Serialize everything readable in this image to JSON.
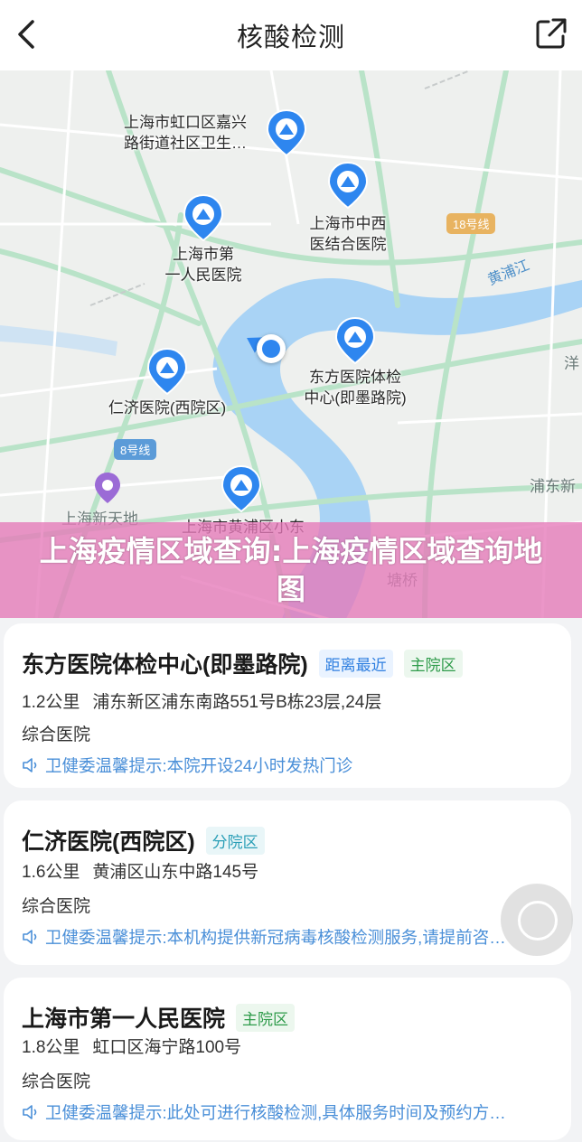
{
  "header": {
    "title": "核酸检测"
  },
  "map": {
    "pins": [
      {
        "label": "上海市虹口区嘉兴\n路街道社区卫生…"
      },
      {
        "label": "上海市中西\n医结合医院"
      },
      {
        "label": "上海市第\n一人民医院"
      },
      {
        "label": "东方医院体检\n中心(即墨路院)"
      },
      {
        "label": "仁济医院(西院区)"
      },
      {
        "label": "上海市黄浦区小东"
      }
    ],
    "metro_badges": [
      "18号线",
      "8号线"
    ],
    "place_labels": {
      "xintiandi": "上海新天地",
      "pudong": "浦东新",
      "tangqiao": "塘桥",
      "yang": "洋",
      "river": "黄浦江"
    }
  },
  "banner": {
    "text": "上海疫情区域查询:上海疫情区域查询地图"
  },
  "hospitals": [
    {
      "name": "东方医院体检中心(即墨路院)",
      "tags": [
        {
          "text": "距离最近",
          "color": "blue"
        },
        {
          "text": "主院区",
          "color": "green"
        }
      ],
      "distance": "1.2公里",
      "address": "浦东新区浦东南路551号B栋23层,24层",
      "type": "综合医院",
      "tip": "卫健委温馨提示:本院开设24小时发热门诊"
    },
    {
      "name": "仁济医院(西院区)",
      "tags": [
        {
          "text": "分院区",
          "color": "cyan"
        }
      ],
      "distance": "1.6公里",
      "address": "黄浦区山东中路145号",
      "type": "综合医院",
      "tip": "卫健委温馨提示:本机构提供新冠病毒核酸检测服务,请提前咨…"
    },
    {
      "name": "上海市第一人民医院",
      "tags": [
        {
          "text": "主院区",
          "color": "green"
        }
      ],
      "distance": "1.8公里",
      "address": "虹口区海宁路100号",
      "type": "综合医院",
      "tip": "卫健委温馨提示:此处可进行核酸检测,具体服务时间及预约方…"
    }
  ],
  "colors": {
    "accent": "#2e86ef",
    "banner": "#e678b9",
    "tip": "#4a8fd8",
    "river": "#a9d3f5"
  }
}
